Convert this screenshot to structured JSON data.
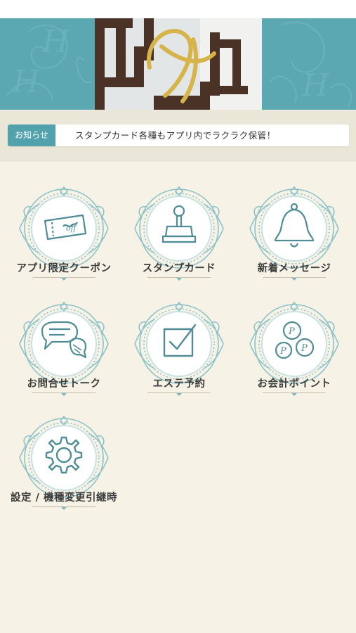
{
  "colors": {
    "accent": "#5ba8b2",
    "tag": "#52a2ad",
    "icon_stroke": "#4f8c95",
    "background": "#f6f3e6"
  },
  "header": {
    "image": "salon-logo-photo"
  },
  "notice": {
    "tag_label": "お知らせ",
    "message": "スタンプカード各種もアプリ内でラクラク保管！"
  },
  "menu": {
    "items": [
      {
        "label": "アプリ限定クーポン",
        "icon": "coupon-icon"
      },
      {
        "label": "スタンプカード",
        "icon": "stamp-icon"
      },
      {
        "label": "新着メッセージ",
        "icon": "bell-icon"
      },
      {
        "label": "お問合せトーク",
        "icon": "chat-bubbles-icon"
      },
      {
        "label": "エステ予約",
        "icon": "checkbox-icon"
      },
      {
        "label": "お会計ポイント",
        "icon": "point-coins-icon"
      },
      {
        "label": "設定 / 機種変更引継時",
        "icon": "gear-icon"
      }
    ]
  }
}
